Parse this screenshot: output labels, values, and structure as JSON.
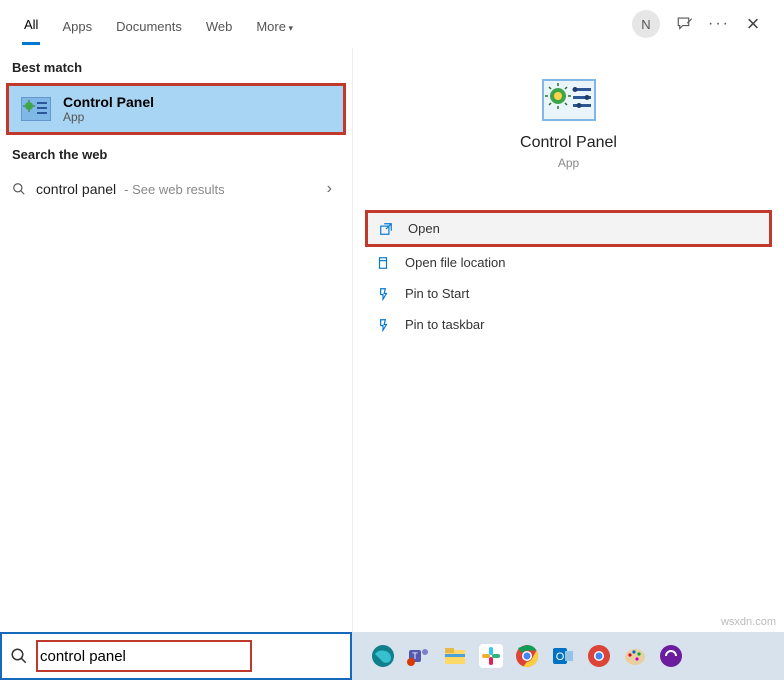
{
  "tabs": {
    "all": "All",
    "apps": "Apps",
    "documents": "Documents",
    "web": "Web",
    "more": "More"
  },
  "avatar_initial": "N",
  "sections": {
    "best_match": "Best match",
    "search_web": "Search the web"
  },
  "best_match": {
    "title": "Control Panel",
    "sub": "App"
  },
  "web_result": {
    "query": "control panel",
    "hint": " - See web results"
  },
  "preview": {
    "title": "Control Panel",
    "sub": "App"
  },
  "actions": {
    "open": "Open",
    "file_loc": "Open file location",
    "pin_start": "Pin to Start",
    "pin_taskbar": "Pin to taskbar"
  },
  "search_value": "control panel",
  "watermark": "wsxdn.com"
}
